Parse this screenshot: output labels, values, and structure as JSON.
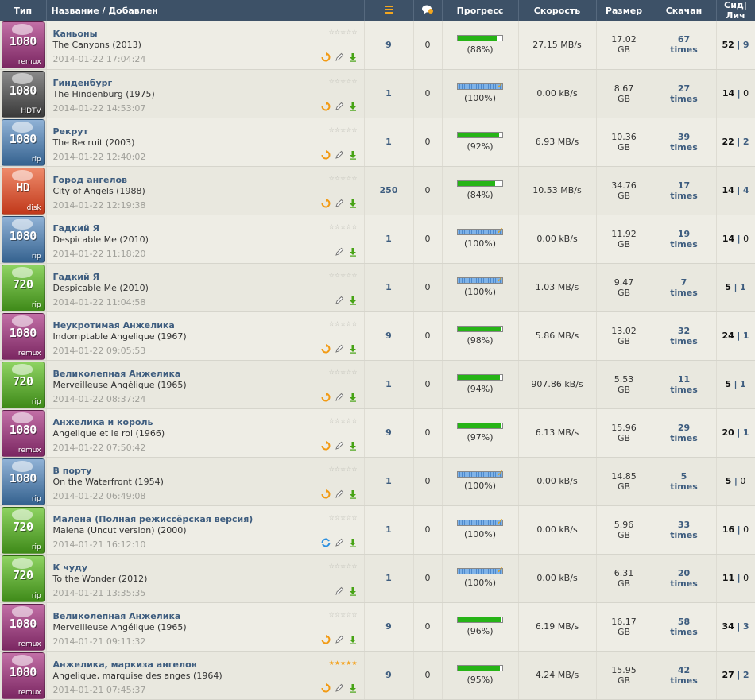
{
  "header": {
    "type": "Тип",
    "name": "Название / Добавлен",
    "progress": "Прогресс",
    "speed": "Скорость",
    "size": "Размер",
    "downloaded": "Скачан",
    "seeds_leechs": "Сид|Лич"
  },
  "rows": [
    {
      "badge": {
        "res": "1080",
        "kind": "remux",
        "style": "remux"
      },
      "title_ru": "Каньоны",
      "title": "The Canyons (2013)",
      "date": "2014-01-22 17:04:24",
      "stars": "☆☆☆☆☆",
      "rated": false,
      "actions": [
        "reload",
        "edit",
        "download"
      ],
      "files": "9",
      "comments": "0",
      "progress": "(88%)",
      "pct": 88,
      "speed": "27.15 MB/s",
      "size": "17.02",
      "size_unit": "GB",
      "snatched": "67",
      "times": "times",
      "seeders": "52",
      "sep": "|",
      "leechers": "9",
      "leech_zero": false
    },
    {
      "badge": {
        "res": "1080",
        "kind": "HDTV",
        "style": "hdtv"
      },
      "title_ru": "Гинденбург",
      "title": "The Hindenburg (1975)",
      "date": "2014-01-22 14:53:07",
      "stars": "☆☆☆☆☆",
      "rated": false,
      "actions": [
        "reload",
        "edit",
        "download"
      ],
      "files": "1",
      "comments": "0",
      "progress": "(100%)",
      "pct": 100,
      "speed": "0.00 kB/s",
      "size": "8.67",
      "size_unit": "GB",
      "snatched": "27",
      "times": "times",
      "seeders": "14",
      "sep": "|",
      "leechers": "0",
      "leech_zero": true
    },
    {
      "badge": {
        "res": "1080",
        "kind": "rip",
        "style": "rip1080"
      },
      "title_ru": "Рекрут",
      "title": "The Recruit (2003)",
      "date": "2014-01-22 12:40:02",
      "stars": "☆☆☆☆☆",
      "rated": false,
      "actions": [
        "reload",
        "edit",
        "download"
      ],
      "files": "1",
      "comments": "0",
      "progress": "(92%)",
      "pct": 92,
      "speed": "6.93 MB/s",
      "size": "10.36",
      "size_unit": "GB",
      "snatched": "39",
      "times": "times",
      "seeders": "22",
      "sep": "|",
      "leechers": "2",
      "leech_zero": false
    },
    {
      "badge": {
        "res": "HD",
        "kind": "disk",
        "style": "hddisk"
      },
      "title_ru": "Город ангелов",
      "title": "City of Angels (1988)",
      "date": "2014-01-22 12:19:38",
      "stars": "☆☆☆☆☆",
      "rated": false,
      "actions": [
        "reload",
        "edit",
        "download"
      ],
      "files": "250",
      "comments": "0",
      "progress": "(84%)",
      "pct": 84,
      "speed": "10.53 MB/s",
      "size": "34.76",
      "size_unit": "GB",
      "snatched": "17",
      "times": "times",
      "seeders": "14",
      "sep": "|",
      "leechers": "4",
      "leech_zero": false
    },
    {
      "badge": {
        "res": "1080",
        "kind": "rip",
        "style": "rip1080"
      },
      "title_ru": "Гадкий Я",
      "title": "Despicable Me (2010)",
      "date": "2014-01-22 11:18:20",
      "stars": "☆☆☆☆☆",
      "rated": false,
      "actions": [
        "edit",
        "download"
      ],
      "files": "1",
      "comments": "0",
      "progress": "(100%)",
      "pct": 100,
      "speed": "0.00 kB/s",
      "size": "11.92",
      "size_unit": "GB",
      "snatched": "19",
      "times": "times",
      "seeders": "14",
      "sep": "|",
      "leechers": "0",
      "leech_zero": true
    },
    {
      "badge": {
        "res": "720",
        "kind": "rip",
        "style": "rip720"
      },
      "title_ru": "Гадкий Я",
      "title": "Despicable Me (2010)",
      "date": "2014-01-22 11:04:58",
      "stars": "☆☆☆☆☆",
      "rated": false,
      "actions": [
        "edit",
        "download"
      ],
      "files": "1",
      "comments": "0",
      "progress": "(100%)",
      "pct": 100,
      "speed": "1.03 MB/s",
      "size": "9.47",
      "size_unit": "GB",
      "snatched": "7",
      "times": "times",
      "seeders": "5",
      "sep": "|",
      "leechers": "1",
      "leech_zero": false
    },
    {
      "badge": {
        "res": "1080",
        "kind": "remux",
        "style": "remux"
      },
      "title_ru": "Неукротимая Анжелика",
      "title": "Indomptable Angelique (1967)",
      "date": "2014-01-22 09:05:53",
      "stars": "☆☆☆☆☆",
      "rated": false,
      "actions": [
        "reload",
        "edit",
        "download"
      ],
      "files": "9",
      "comments": "0",
      "progress": "(98%)",
      "pct": 98,
      "speed": "5.86 MB/s",
      "size": "13.02",
      "size_unit": "GB",
      "snatched": "32",
      "times": "times",
      "seeders": "24",
      "sep": "|",
      "leechers": "1",
      "leech_zero": false
    },
    {
      "badge": {
        "res": "720",
        "kind": "rip",
        "style": "rip720"
      },
      "title_ru": "Великолепная Анжелика",
      "title": "Merveilleuse Angélique (1965)",
      "date": "2014-01-22 08:37:24",
      "stars": "☆☆☆☆☆",
      "rated": false,
      "actions": [
        "reload",
        "edit",
        "download"
      ],
      "files": "1",
      "comments": "0",
      "progress": "(94%)",
      "pct": 94,
      "speed": "907.86 kB/s",
      "size": "5.53",
      "size_unit": "GB",
      "snatched": "11",
      "times": "times",
      "seeders": "5",
      "sep": "|",
      "leechers": "1",
      "leech_zero": false
    },
    {
      "badge": {
        "res": "1080",
        "kind": "remux",
        "style": "remux"
      },
      "title_ru": "Анжелика и король",
      "title": "Angelique et le roi (1966)",
      "date": "2014-01-22 07:50:42",
      "stars": "☆☆☆☆☆",
      "rated": false,
      "actions": [
        "reload",
        "edit",
        "download"
      ],
      "files": "9",
      "comments": "0",
      "progress": "(97%)",
      "pct": 97,
      "speed": "6.13 MB/s",
      "size": "15.96",
      "size_unit": "GB",
      "snatched": "29",
      "times": "times",
      "seeders": "20",
      "sep": "|",
      "leechers": "1",
      "leech_zero": false
    },
    {
      "badge": {
        "res": "1080",
        "kind": "rip",
        "style": "rip1080"
      },
      "title_ru": "В порту",
      "title": "On the Waterfront (1954)",
      "date": "2014-01-22 06:49:08",
      "stars": "☆☆☆☆☆",
      "rated": false,
      "actions": [
        "reload",
        "edit",
        "download"
      ],
      "files": "1",
      "comments": "0",
      "progress": "(100%)",
      "pct": 100,
      "speed": "0.00 kB/s",
      "size": "14.85",
      "size_unit": "GB",
      "snatched": "5",
      "times": "times",
      "seeders": "5",
      "sep": "|",
      "leechers": "0",
      "leech_zero": true
    },
    {
      "badge": {
        "res": "720",
        "kind": "rip",
        "style": "rip720"
      },
      "title_ru": "Малена (Полная режиссёрская версия)",
      "title": "Malena (Uncut version) (2000)",
      "date": "2014-01-21 16:12:10",
      "stars": "☆☆☆☆☆",
      "rated": false,
      "actions": [
        "refresh",
        "edit",
        "download"
      ],
      "files": "1",
      "comments": "0",
      "progress": "(100%)",
      "pct": 100,
      "speed": "0.00 kB/s",
      "size": "5.96",
      "size_unit": "GB",
      "snatched": "33",
      "times": "times",
      "seeders": "16",
      "sep": "|",
      "leechers": "0",
      "leech_zero": true
    },
    {
      "badge": {
        "res": "720",
        "kind": "rip",
        "style": "rip720"
      },
      "title_ru": "К чуду",
      "title": "To the Wonder (2012)",
      "date": "2014-01-21 13:35:35",
      "stars": "☆☆☆☆☆",
      "rated": false,
      "actions": [
        "edit",
        "download"
      ],
      "files": "1",
      "comments": "0",
      "progress": "(100%)",
      "pct": 100,
      "speed": "0.00 kB/s",
      "size": "6.31",
      "size_unit": "GB",
      "snatched": "20",
      "times": "times",
      "seeders": "11",
      "sep": "|",
      "leechers": "0",
      "leech_zero": true
    },
    {
      "badge": {
        "res": "1080",
        "kind": "remux",
        "style": "remux"
      },
      "title_ru": "Великолепная Анжелика",
      "title": "Merveilleuse Angélique (1965)",
      "date": "2014-01-21 09:11:32",
      "stars": "☆☆☆☆☆",
      "rated": false,
      "actions": [
        "reload",
        "edit",
        "download"
      ],
      "files": "9",
      "comments": "0",
      "progress": "(96%)",
      "pct": 96,
      "speed": "6.19 MB/s",
      "size": "16.17",
      "size_unit": "GB",
      "snatched": "58",
      "times": "times",
      "seeders": "34",
      "sep": "|",
      "leechers": "3",
      "leech_zero": false
    },
    {
      "badge": {
        "res": "1080",
        "kind": "remux",
        "style": "remux"
      },
      "title_ru": "Анжелика, маркиза ангелов",
      "title": "Angelique, marquise des anges (1964)",
      "date": "2014-01-21 07:45:37",
      "stars": "★★★★★",
      "rated": true,
      "actions": [
        "reload",
        "edit",
        "download"
      ],
      "files": "9",
      "comments": "0",
      "progress": "(95%)",
      "pct": 95,
      "speed": "4.24 MB/s",
      "size": "15.95",
      "size_unit": "GB",
      "snatched": "42",
      "times": "times",
      "seeders": "27",
      "sep": "|",
      "leechers": "2",
      "leech_zero": false
    }
  ]
}
